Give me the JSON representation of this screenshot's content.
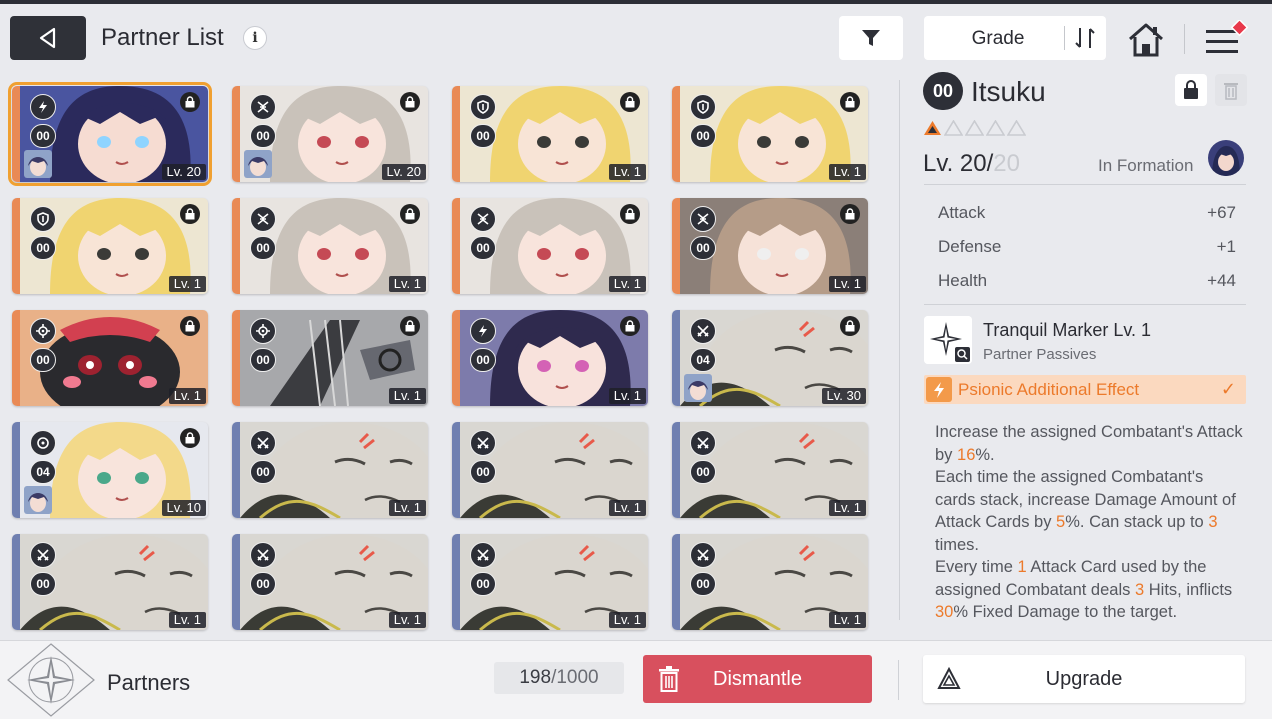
{
  "header": {
    "title": "Partner List",
    "info_glyph": "i",
    "sort_label": "Grade"
  },
  "colors": {
    "accent_orange": "#ec7a2b",
    "dismantle_red": "#d8505e",
    "selected_outline": "#f0a030",
    "stripe_orange": "#e98a55",
    "stripe_blue": "#6f7fb0"
  },
  "partners": [
    {
      "class_icon": "psionic-icon",
      "tier": "00",
      "level": "Lv. 20",
      "locked": true,
      "stripe": "orange",
      "art": "dark-hair-girl",
      "mini_avatar": true,
      "selected": true
    },
    {
      "class_icon": "swords-icon",
      "tier": "00",
      "level": "Lv. 20",
      "locked": true,
      "stripe": "orange",
      "art": "gray-hair-girl",
      "mini_avatar": true,
      "selected": false
    },
    {
      "class_icon": "shield-icon",
      "tier": "00",
      "level": "Lv. 1",
      "locked": true,
      "stripe": "orange",
      "art": "blonde-headset-girl",
      "mini_avatar": false,
      "selected": false
    },
    {
      "class_icon": "shield-icon",
      "tier": "00",
      "level": "Lv. 1",
      "locked": true,
      "stripe": "orange",
      "art": "blonde-headset-girl",
      "mini_avatar": false,
      "selected": false
    },
    {
      "class_icon": "shield-icon",
      "tier": "00",
      "level": "Lv. 1",
      "locked": true,
      "stripe": "orange",
      "art": "blonde-headset-girl",
      "mini_avatar": false,
      "selected": false
    },
    {
      "class_icon": "swords-icon",
      "tier": "00",
      "level": "Lv. 1",
      "locked": true,
      "stripe": "orange",
      "art": "gray-hair-girl",
      "mini_avatar": false,
      "selected": false
    },
    {
      "class_icon": "swords-icon",
      "tier": "00",
      "level": "Lv. 1",
      "locked": true,
      "stripe": "orange",
      "art": "gray-hair-girl",
      "mini_avatar": false,
      "selected": false
    },
    {
      "class_icon": "swords-icon",
      "tier": "00",
      "level": "Lv. 1",
      "locked": true,
      "stripe": "orange",
      "art": "brown-hair-girl",
      "mini_avatar": false,
      "selected": false
    },
    {
      "class_icon": "target-icon",
      "tier": "00",
      "level": "Lv. 1",
      "locked": true,
      "stripe": "orange",
      "art": "black-creature",
      "mini_avatar": false,
      "selected": false
    },
    {
      "class_icon": "target-icon",
      "tier": "00",
      "level": "Lv. 1",
      "locked": true,
      "stripe": "orange",
      "art": "mech-claw",
      "mini_avatar": false,
      "selected": false
    },
    {
      "class_icon": "psionic-icon",
      "tier": "00",
      "level": "Lv. 1",
      "locked": true,
      "stripe": "orange",
      "art": "glasses-girl",
      "mini_avatar": false,
      "selected": false
    },
    {
      "class_icon": "crossed-swords-icon",
      "tier": "04",
      "level": "Lv. 30",
      "locked": true,
      "stripe": "blue",
      "art": "gray-creature",
      "mini_avatar": true,
      "selected": false
    },
    {
      "class_icon": "circle-icon",
      "tier": "04",
      "level": "Lv. 10",
      "locked": true,
      "stripe": "blue",
      "art": "blonde-veil-girl",
      "mini_avatar": true,
      "selected": false
    },
    {
      "class_icon": "crossed-swords-icon",
      "tier": "00",
      "level": "Lv. 1",
      "locked": false,
      "stripe": "blue",
      "art": "gray-creature",
      "mini_avatar": false,
      "selected": false
    },
    {
      "class_icon": "crossed-swords-icon",
      "tier": "00",
      "level": "Lv. 1",
      "locked": false,
      "stripe": "blue",
      "art": "gray-creature",
      "mini_avatar": false,
      "selected": false
    },
    {
      "class_icon": "crossed-swords-icon",
      "tier": "00",
      "level": "Lv. 1",
      "locked": false,
      "stripe": "blue",
      "art": "gray-creature",
      "mini_avatar": false,
      "selected": false
    },
    {
      "class_icon": "crossed-swords-icon",
      "tier": "00",
      "level": "Lv. 1",
      "locked": false,
      "stripe": "blue",
      "art": "gray-creature",
      "mini_avatar": false,
      "selected": false
    },
    {
      "class_icon": "crossed-swords-icon",
      "tier": "00",
      "level": "Lv. 1",
      "locked": false,
      "stripe": "blue",
      "art": "gray-creature",
      "mini_avatar": false,
      "selected": false
    },
    {
      "class_icon": "crossed-swords-icon",
      "tier": "00",
      "level": "Lv. 1",
      "locked": false,
      "stripe": "blue",
      "art": "gray-creature",
      "mini_avatar": false,
      "selected": false
    },
    {
      "class_icon": "crossed-swords-icon",
      "tier": "00",
      "level": "Lv. 1",
      "locked": false,
      "stripe": "blue",
      "art": "gray-creature",
      "mini_avatar": false,
      "selected": false
    }
  ],
  "detail": {
    "tier": "00",
    "name": "Itsuku",
    "stars_filled": 1,
    "stars_total": 5,
    "level_current": "Lv. 20/",
    "level_max": "20",
    "formation_label": "In Formation",
    "stats": [
      {
        "label": "Attack",
        "value": "+67"
      },
      {
        "label": "Defense",
        "value": "+1"
      },
      {
        "label": "Health",
        "value": "+44"
      }
    ],
    "passive": {
      "title": "Tranquil Marker Lv. 1",
      "subtitle": "Partner Passives",
      "effect_label": "Psionic Additional Effect",
      "check": "✓"
    },
    "description": [
      [
        {
          "t": "Increase the assigned Combatant's Attack by "
        },
        {
          "t": "16",
          "hl": true
        },
        {
          "t": "%."
        }
      ],
      [
        {
          "t": "Each time the assigned Combatant's cards stack, increase Damage Amount of Attack Cards by "
        },
        {
          "t": "5",
          "hl": true
        },
        {
          "t": "%. Can stack up to "
        },
        {
          "t": "3",
          "hl": true
        },
        {
          "t": " times."
        }
      ],
      [
        {
          "t": "Every time "
        },
        {
          "t": "1",
          "hl": true
        },
        {
          "t": " Attack Card used by the assigned Combatant deals "
        },
        {
          "t": "3",
          "hl": true
        },
        {
          "t": " Hits, inflicts "
        },
        {
          "t": "30",
          "hl": true
        },
        {
          "t": "% Fixed Damage to the target."
        }
      ]
    ]
  },
  "footer": {
    "section_label": "Partners",
    "count_current": "198",
    "count_sep": " / ",
    "count_max": "1000",
    "dismantle_label": "Dismantle",
    "upgrade_label": "Upgrade"
  }
}
